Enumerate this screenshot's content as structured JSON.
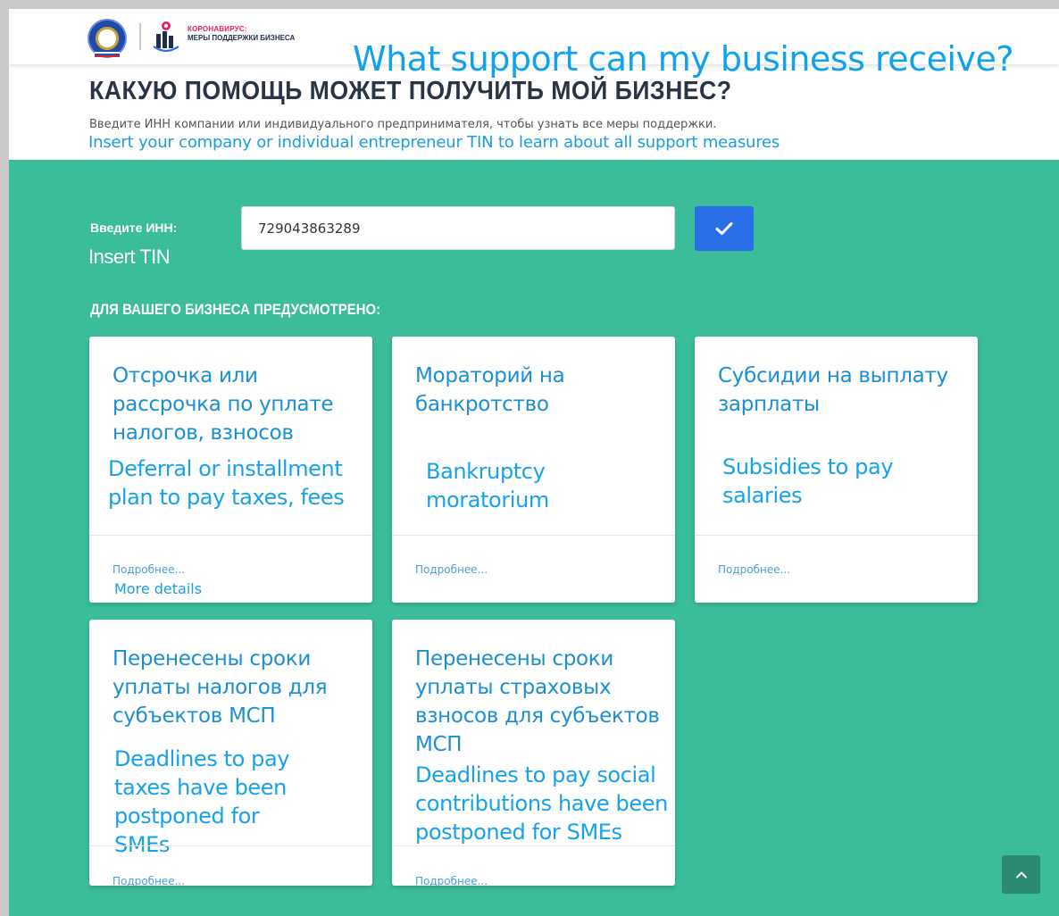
{
  "header": {
    "logo_title": "КОРОНАВИРУС:",
    "logo_subtitle": "МЕРЫ ПОДДЕРЖКИ БИЗНЕСА",
    "overlay_title": "What support can my business receive?",
    "heading": "КАКУЮ ПОМОЩЬ МОЖЕТ ПОЛУЧИТЬ МОЙ БИЗНЕС?",
    "description_ru": "Введите ИНН компании или индивидуального предпринимателя, чтобы узнать все меры поддержки.",
    "description_en": "Insert your company or individual entrepreneur TIN to learn about all support measures"
  },
  "form": {
    "label_ru": "Введите ИНН:",
    "label_en": "Insert TIN",
    "inn_value": "729043863289",
    "submit_icon": "check-icon"
  },
  "section": {
    "heading": "ДЛЯ ВАШЕГО БИЗНЕСА ПРЕДУСМОТРЕНО:"
  },
  "cards": [
    {
      "title_ru": "Отсрочка или рассрочка по уплате налогов, взносов",
      "title_en": "Deferral or installment plan to pay taxes, fees",
      "more_ru": "Подробнее...",
      "more_en": "More details"
    },
    {
      "title_ru": "Мораторий на банкротство",
      "title_en": "Bankruptcy moratorium",
      "more_ru": "Подробнее..."
    },
    {
      "title_ru": "Субсидии на выплату зарплаты",
      "title_en": "Subsidies to pay salaries",
      "more_ru": "Подробнее..."
    },
    {
      "title_ru": "Перенесены сроки уплаты налогов для субъектов МСП",
      "title_en": "Deadlines to pay taxes have been postponed for SMEs",
      "more_ru": "Подробнее..."
    },
    {
      "title_ru": "Перенесены сроки уплаты страховых взносов для субъектов МСП",
      "title_en": "Deadlines to pay social contributions have been postponed for SMEs",
      "more_ru": "Подробнее..."
    }
  ],
  "scroll_top_icon": "chevron-up-icon",
  "colors": {
    "background": "#3bbd9b",
    "accent_button": "#2a6fe8",
    "title_blue": "#1b8fd2",
    "logo_red": "#e2245e",
    "heading_dark": "#2a3447"
  }
}
